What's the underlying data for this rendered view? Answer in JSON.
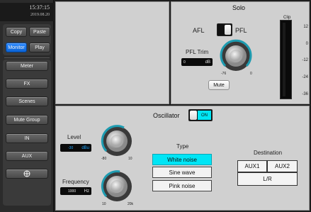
{
  "clock": {
    "time": "15:37:15",
    "date": "2019.08.20"
  },
  "sidebar": {
    "copy": "Copy",
    "paste": "Paste",
    "monitor": "Monitor",
    "play": "Play",
    "items": [
      "Meter",
      "FX",
      "Scenes",
      "Mute Group",
      "IN",
      "AUX"
    ],
    "target_icon": "crosshair-icon"
  },
  "solo": {
    "title": "Solo",
    "afl": "AFL",
    "pfl": "PFL",
    "pfl_trim_label": "PFL Trim",
    "trim_value": "0",
    "trim_unit": "dB",
    "trim_min": "-76",
    "trim_max": "0",
    "mute": "Mute",
    "clip_label": "Clip",
    "meter_ticks": [
      "12",
      "0",
      "-12",
      "-24",
      "-36"
    ]
  },
  "oscillator": {
    "title": "Oscillator",
    "toggle_label": "ON",
    "level_label": "Level",
    "level_value": "-30",
    "level_unit": "dBu",
    "level_min": "-80",
    "level_max": "10",
    "frequency_label": "Frequency",
    "frequency_value": "1000",
    "frequency_unit": "Hz",
    "freq_min": "10",
    "freq_max": "20k",
    "type_label": "Type",
    "types": [
      "White noise",
      "Sine wave",
      "Pink noise"
    ],
    "selected_type": "White noise",
    "destination_label": "Destination",
    "destinations": [
      "AUX1",
      "AUX2",
      "L/R"
    ]
  },
  "colors": {
    "accent": "#00e5f5",
    "active_blue": "#0a63d6",
    "knob_arc": "#1e9bb0"
  }
}
